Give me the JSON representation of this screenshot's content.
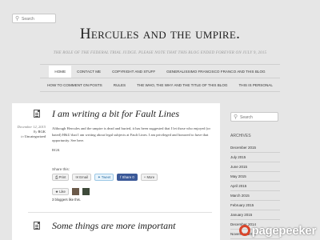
{
  "header": {
    "search_placeholder": "Search",
    "site_title": "Hercules and the umpire.",
    "tagline": "The role of the federal trial judge. Please note that this blog ended forever on July 9, 2015"
  },
  "nav": {
    "row1": [
      "Home",
      "Contact Me",
      "Copyright and stuff",
      "Generalissimo Francisco Franco and this blog"
    ],
    "row2": [
      "How to comment on posts",
      "Rules",
      "The who, the why and the title of this blog",
      "This is personal"
    ]
  },
  "post": {
    "title": "I am writing a bit for Fault Lines",
    "date": "December 12, 2015",
    "by": "By",
    "author": "RGK",
    "in": "in",
    "category": "Uncategorized",
    "body": "Although Hercules and the umpire is dead and buried, it has been suggested that I let those who enjoyed (or hated) H&U that I am writing about legal subjects at Fault Lines. I am privileged and honored to have that opportunity. See here.",
    "signature": "RGK",
    "share_title": "Share this:",
    "share_buttons": [
      "Print",
      "Email",
      "Tweet",
      "Share 0",
      "More"
    ],
    "like_label": "Like",
    "bloggers_count": "3 bloggers",
    "bloggers_suffix": "like this."
  },
  "post2": {
    "title": "Some things are more important"
  },
  "sidebar": {
    "search_placeholder": "Search",
    "archives_title": "Archives",
    "archives": [
      "December 2015",
      "July 2015",
      "June 2015",
      "May 2015",
      "April 2015",
      "March 2015",
      "February 2015",
      "January 2015",
      "December 2014",
      "November 2014"
    ]
  },
  "watermark": {
    "text_page": "page",
    "text_peeker": "peeker"
  }
}
